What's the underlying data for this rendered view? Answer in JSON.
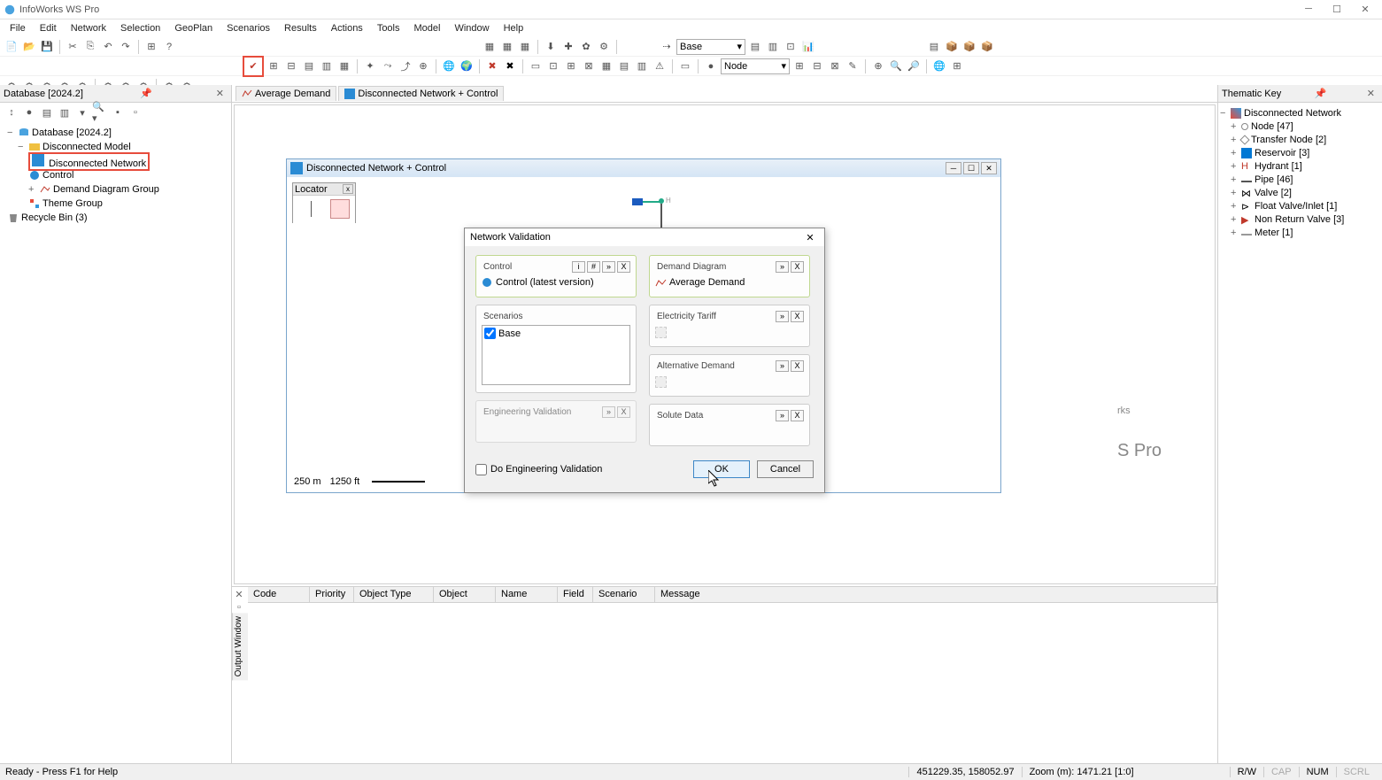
{
  "app": {
    "title": "InfoWorks WS Pro"
  },
  "menu": [
    "File",
    "Edit",
    "Network",
    "Selection",
    "GeoPlan",
    "Scenarios",
    "Results",
    "Actions",
    "Tools",
    "Model",
    "Window",
    "Help"
  ],
  "toolbar_combo1": "Base",
  "toolbar_combo2": "Node",
  "left_panel": {
    "title": "Database [2024.2]",
    "root": "Database [2024.2]",
    "model": "Disconnected Model",
    "network": "Disconnected Network",
    "control": "Control",
    "demand": "Demand Diagram Group",
    "theme": "Theme Group",
    "recycle": "Recycle Bin (3)"
  },
  "tabs": {
    "t1": "Average Demand",
    "t2": "Disconnected Network + Control"
  },
  "inner_window": {
    "title": "Disconnected Network + Control",
    "locator": "Locator",
    "scale_m": "250 m",
    "scale_ft": "1250 ft"
  },
  "watermark": {
    "big": "rks",
    "sub": "S Pro"
  },
  "dialog": {
    "title": "Network Validation",
    "control_legend": "Control",
    "control_value": "Control (latest version)",
    "scenarios_legend": "Scenarios",
    "scenario_base": "Base",
    "engval_legend": "Engineering Validation",
    "demand_legend": "Demand Diagram",
    "demand_value": "Average Demand",
    "elec_legend": "Electricity Tariff",
    "alt_legend": "Alternative Demand",
    "solute_legend": "Solute Data",
    "do_eng": "Do Engineering Validation",
    "ok": "OK",
    "cancel": "Cancel"
  },
  "output": {
    "tab": "Output Window",
    "headers": [
      "Code",
      "Priority",
      "Object Type",
      "Object",
      "Name",
      "Field",
      "Scenario",
      "Message"
    ]
  },
  "right_panel": {
    "title": "Thematic Key",
    "root": "Disconnected Network",
    "items": [
      "Node [47]",
      "Transfer Node [2]",
      "Reservoir [3]",
      "Hydrant [1]",
      "Pipe [46]",
      "Valve [2]",
      "Float Valve/Inlet [1]",
      "Non Return Valve [3]",
      "Meter [1]"
    ]
  },
  "status": {
    "ready": "Ready - Press F1 for Help",
    "coords": "451229.35, 158052.97",
    "zoom": "Zoom (m): 1471.21 [1:0]",
    "rw": "R/W",
    "cap": "CAP",
    "num": "NUM",
    "scrl": "SCRL"
  }
}
